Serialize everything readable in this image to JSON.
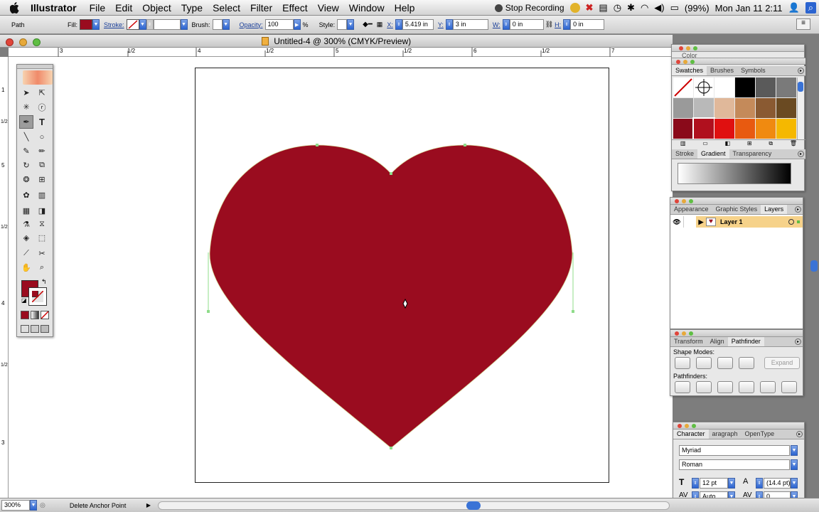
{
  "menubar": {
    "app": "Illustrator",
    "items": [
      "File",
      "Edit",
      "Object",
      "Type",
      "Select",
      "Filter",
      "Effect",
      "View",
      "Window",
      "Help"
    ],
    "recording": "Stop Recording",
    "battery": "(99%)",
    "clock": "Mon Jan 11  2:11"
  },
  "control": {
    "path_label": "Path",
    "fill_label": "Fill:",
    "stroke_label": "Stroke:",
    "brush_label": "Brush:",
    "opacity_label": "Opacity:",
    "opacity_value": "100",
    "percent": "%",
    "style_label": "Style:",
    "x_label": "X:",
    "x_value": "5.419 in",
    "y_label": "Y:",
    "y_value": "3 in",
    "w_label": "W:",
    "w_value": "0 in",
    "h_label": "H:",
    "h_value": "0 in",
    "fill_color": "#9a0c1f"
  },
  "document": {
    "title": "Untitled-4 @ 300% (CMYK/Preview)",
    "zoom": "300%",
    "status_text": "Delete Anchor Point",
    "heart_color": "#9a0c1f"
  },
  "rulers": {
    "top": [
      "3",
      "1/2",
      "4",
      "1/2",
      "5",
      "1/2",
      "6",
      "1/2",
      "7"
    ],
    "left": [
      "1",
      "1/2",
      "5",
      "1/2",
      "4",
      "1/2",
      "3"
    ]
  },
  "panels": {
    "color_tab": "Color",
    "swatch_tabs": [
      "Swatches",
      "Brushes",
      "Symbols"
    ],
    "gradient_tabs": [
      "Stroke",
      "Gradient",
      "Transparency"
    ],
    "layer_tabs": [
      "Appearance",
      "Graphic Styles",
      "Layers"
    ],
    "layer_name": "Layer 1",
    "pathfinder_tabs": [
      "Transform",
      "Align",
      "Pathfinder"
    ],
    "shape_modes": "Shape Modes:",
    "expand": "Expand",
    "pathfinders": "Pathfinders:",
    "character_tabs": [
      "Character",
      "aragraph",
      "OpenType"
    ],
    "font_family": "Myriad",
    "font_style": "Roman",
    "font_size": "12 pt",
    "leading": "(14.4 pt)",
    "kerning": "Auto",
    "tracking": "0"
  },
  "swatches": [
    "none",
    "reg",
    "#ffffff",
    "#000000",
    "#5a5a5a",
    "#7a7a7a",
    "#9a9a9a",
    "#b9b9b9",
    "#e0b89a",
    "#c48a5a",
    "#8a5a32",
    "#6a4a22",
    "#8a0a1a",
    "#b0101e",
    "#e01010",
    "#e85a10",
    "#f08a10",
    "#f5b800"
  ]
}
